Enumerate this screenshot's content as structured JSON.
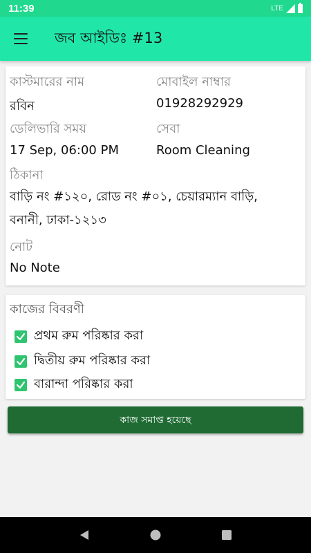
{
  "status_bar": {
    "time": "11:39",
    "network": "LTE"
  },
  "app_bar": {
    "title": "জব আইডিঃ #13"
  },
  "details": {
    "customer_name_label": "কাস্টমারের নাম",
    "customer_name": "রবিন",
    "mobile_label": "মোবাইল নাম্বার",
    "mobile": "01928292929",
    "delivery_time_label": "ডেলিভারি সময়",
    "delivery_time": "17 Sep, 06:00 PM",
    "service_label": "সেবা",
    "service": "Room Cleaning",
    "address_label": "ঠিকানা",
    "address": "বাড়ি নং #১২০, রোড নং #০১, চেয়ারম্যান বাড়ি, বনানী, ঢাকা-১২১৩",
    "note_label": "নোট",
    "note": "No Note"
  },
  "tasks": {
    "title": "কাজের বিবরণী",
    "items": [
      {
        "label": "প্রথম রুম পরিষ্কার করা",
        "checked": true
      },
      {
        "label": "দ্বিতীয় রুম পরিষ্কার করা",
        "checked": true
      },
      {
        "label": "বারান্দা পরিষ্কার করা",
        "checked": true
      }
    ]
  },
  "actions": {
    "complete_label": "কাজ সমাপ্ত হয়েছে"
  },
  "colors": {
    "status_bar": "#20d98f",
    "app_bar": "#20e6a8",
    "button": "#1f6b33",
    "checkbox": "#2fc46f"
  },
  "icons": {
    "menu": "hamburger-menu-icon",
    "back": "back-triangle-icon",
    "home": "home-circle-icon",
    "recents": "recents-square-icon"
  }
}
